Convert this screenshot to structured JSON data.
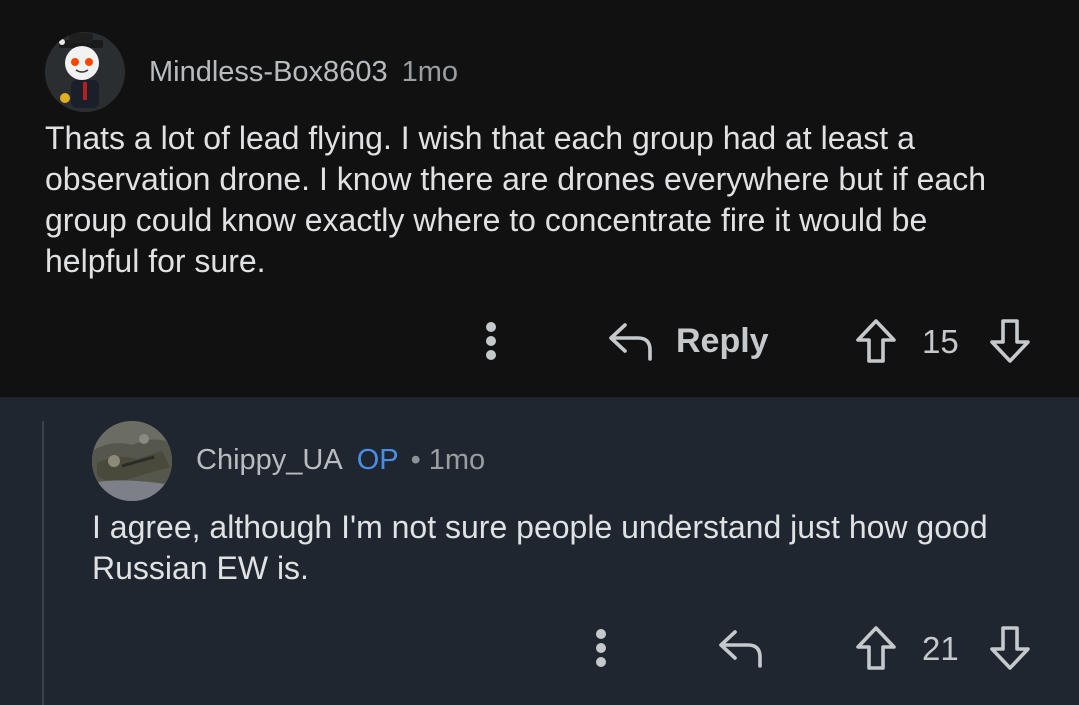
{
  "comments": [
    {
      "username": "Mindless-Box8603",
      "time": "1mo",
      "body": "Thats a lot of lead flying. I wish that each group had at least a observation drone. I know there are drones everywhere but if each group could know exactly where to concentrate fire it would be helpful for sure.",
      "reply_label": "Reply",
      "score": "15"
    },
    {
      "username": "Chippy_UA",
      "badge": "OP",
      "separator": "•",
      "time": "1mo",
      "body": "I agree, although I'm not sure people understand just how good Russian EW is.",
      "score": "21"
    }
  ],
  "icons": {
    "more": "more-vertical-icon",
    "reply": "reply-arrow-icon",
    "upvote": "upvote-arrow-icon",
    "downvote": "downvote-arrow-icon"
  },
  "colors": {
    "op_badge": "#4a8ee4",
    "top_background": "#111111",
    "reply_background": "#1f2630"
  }
}
